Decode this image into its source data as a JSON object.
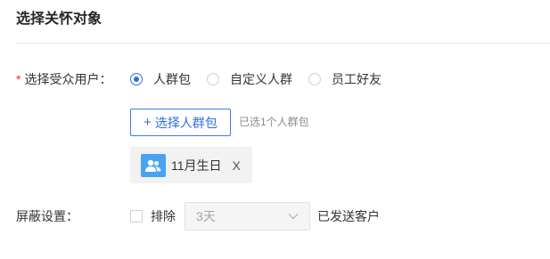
{
  "section": {
    "title": "选择关怀对象"
  },
  "audience": {
    "required_mark": "*",
    "label": "选择受众用户：",
    "options": [
      {
        "label": "人群包",
        "checked": true
      },
      {
        "label": "自定义人群",
        "checked": false
      },
      {
        "label": "员工好友",
        "checked": false
      }
    ],
    "select_button": {
      "plus": "+",
      "label": "选择人群包"
    },
    "selected_hint": "已选1个人群包",
    "selected_tag": {
      "icon": "people-icon",
      "label": "11月生日",
      "close": "X"
    }
  },
  "shield": {
    "label": "屏蔽设置：",
    "checkbox_label": "排除",
    "checked": false,
    "days_select": {
      "value": "3天",
      "disabled": true
    },
    "suffix": "已发送客户"
  },
  "colors": {
    "primary": "#2f6ee0",
    "required": "#e52e2e",
    "tag_icon_bg": "#4aa3f0"
  }
}
